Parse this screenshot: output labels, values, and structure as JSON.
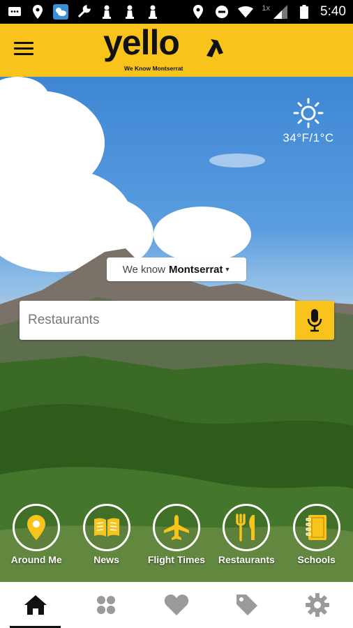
{
  "status_bar": {
    "time": "5:40",
    "speed_badge": "1x"
  },
  "header": {
    "logo_text": "yello",
    "tagline": "We Know Montserrat"
  },
  "weather": {
    "icon": "sun-icon",
    "temperature": "34°F/1°C"
  },
  "location": {
    "prefix": "We know",
    "place": "Montserrat"
  },
  "search": {
    "placeholder": "Restaurants"
  },
  "quick_actions": [
    {
      "label": "Around Me",
      "icon": "location-pin-icon"
    },
    {
      "label": "News",
      "icon": "book-icon"
    },
    {
      "label": "Flight Times",
      "icon": "airplane-icon"
    },
    {
      "label": "Restaurants",
      "icon": "fork-knife-icon"
    },
    {
      "label": "Schools",
      "icon": "notebook-icon"
    }
  ],
  "bottom_nav": [
    {
      "name": "home",
      "icon": "home-icon",
      "active": true
    },
    {
      "name": "categories",
      "icon": "grid-dots-icon",
      "active": false
    },
    {
      "name": "favorites",
      "icon": "heart-icon",
      "active": false
    },
    {
      "name": "deals",
      "icon": "tag-icon",
      "active": false
    },
    {
      "name": "settings",
      "icon": "gear-icon",
      "active": false
    }
  ],
  "colors": {
    "brand_yellow": "#f8c41b",
    "dark": "#111111"
  }
}
